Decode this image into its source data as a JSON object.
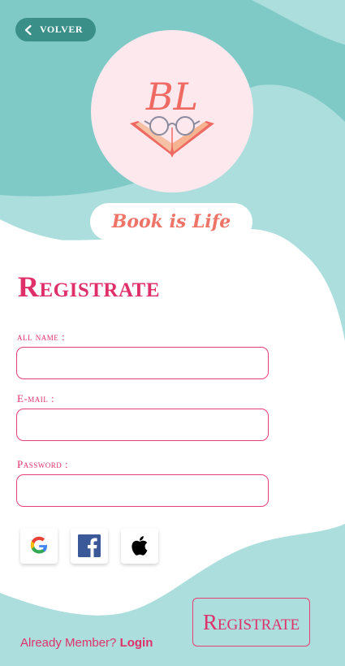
{
  "header": {
    "back_label": "VOLVER"
  },
  "logo": {
    "initials": "BL",
    "brand": "Book is Life"
  },
  "form": {
    "title": "Registrate",
    "fields": [
      {
        "label": "all name :",
        "value": "",
        "placeholder": ""
      },
      {
        "label": "E-mail :",
        "value": "",
        "placeholder": ""
      },
      {
        "label": "Password :",
        "value": "",
        "placeholder": ""
      }
    ]
  },
  "social": [
    {
      "name": "google-icon"
    },
    {
      "name": "facebook-icon"
    },
    {
      "name": "apple-icon"
    }
  ],
  "actions": {
    "register_label": "Registrate"
  },
  "footer": {
    "prompt": "Already Member?",
    "login_label": "Login"
  },
  "colors": {
    "teal": "#7fcac6",
    "teal_light": "#abdedd",
    "accent": "#e0306a",
    "logo_bg": "#fde8ee",
    "back_button": "#3a9089"
  }
}
